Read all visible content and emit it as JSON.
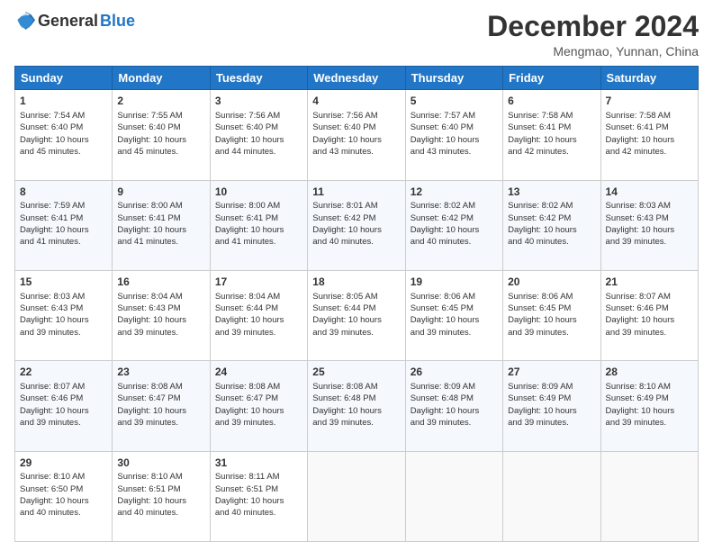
{
  "logo": {
    "general": "General",
    "blue": "Blue"
  },
  "header": {
    "month": "December 2024",
    "location": "Mengmao, Yunnan, China"
  },
  "weekdays": [
    "Sunday",
    "Monday",
    "Tuesday",
    "Wednesday",
    "Thursday",
    "Friday",
    "Saturday"
  ],
  "weeks": [
    [
      {
        "day": "1",
        "lines": [
          "Sunrise: 7:54 AM",
          "Sunset: 6:40 PM",
          "Daylight: 10 hours",
          "and 45 minutes."
        ]
      },
      {
        "day": "2",
        "lines": [
          "Sunrise: 7:55 AM",
          "Sunset: 6:40 PM",
          "Daylight: 10 hours",
          "and 45 minutes."
        ]
      },
      {
        "day": "3",
        "lines": [
          "Sunrise: 7:56 AM",
          "Sunset: 6:40 PM",
          "Daylight: 10 hours",
          "and 44 minutes."
        ]
      },
      {
        "day": "4",
        "lines": [
          "Sunrise: 7:56 AM",
          "Sunset: 6:40 PM",
          "Daylight: 10 hours",
          "and 43 minutes."
        ]
      },
      {
        "day": "5",
        "lines": [
          "Sunrise: 7:57 AM",
          "Sunset: 6:40 PM",
          "Daylight: 10 hours",
          "and 43 minutes."
        ]
      },
      {
        "day": "6",
        "lines": [
          "Sunrise: 7:58 AM",
          "Sunset: 6:41 PM",
          "Daylight: 10 hours",
          "and 42 minutes."
        ]
      },
      {
        "day": "7",
        "lines": [
          "Sunrise: 7:58 AM",
          "Sunset: 6:41 PM",
          "Daylight: 10 hours",
          "and 42 minutes."
        ]
      }
    ],
    [
      {
        "day": "8",
        "lines": [
          "Sunrise: 7:59 AM",
          "Sunset: 6:41 PM",
          "Daylight: 10 hours",
          "and 41 minutes."
        ]
      },
      {
        "day": "9",
        "lines": [
          "Sunrise: 8:00 AM",
          "Sunset: 6:41 PM",
          "Daylight: 10 hours",
          "and 41 minutes."
        ]
      },
      {
        "day": "10",
        "lines": [
          "Sunrise: 8:00 AM",
          "Sunset: 6:41 PM",
          "Daylight: 10 hours",
          "and 41 minutes."
        ]
      },
      {
        "day": "11",
        "lines": [
          "Sunrise: 8:01 AM",
          "Sunset: 6:42 PM",
          "Daylight: 10 hours",
          "and 40 minutes."
        ]
      },
      {
        "day": "12",
        "lines": [
          "Sunrise: 8:02 AM",
          "Sunset: 6:42 PM",
          "Daylight: 10 hours",
          "and 40 minutes."
        ]
      },
      {
        "day": "13",
        "lines": [
          "Sunrise: 8:02 AM",
          "Sunset: 6:42 PM",
          "Daylight: 10 hours",
          "and 40 minutes."
        ]
      },
      {
        "day": "14",
        "lines": [
          "Sunrise: 8:03 AM",
          "Sunset: 6:43 PM",
          "Daylight: 10 hours",
          "and 39 minutes."
        ]
      }
    ],
    [
      {
        "day": "15",
        "lines": [
          "Sunrise: 8:03 AM",
          "Sunset: 6:43 PM",
          "Daylight: 10 hours",
          "and 39 minutes."
        ]
      },
      {
        "day": "16",
        "lines": [
          "Sunrise: 8:04 AM",
          "Sunset: 6:43 PM",
          "Daylight: 10 hours",
          "and 39 minutes."
        ]
      },
      {
        "day": "17",
        "lines": [
          "Sunrise: 8:04 AM",
          "Sunset: 6:44 PM",
          "Daylight: 10 hours",
          "and 39 minutes."
        ]
      },
      {
        "day": "18",
        "lines": [
          "Sunrise: 8:05 AM",
          "Sunset: 6:44 PM",
          "Daylight: 10 hours",
          "and 39 minutes."
        ]
      },
      {
        "day": "19",
        "lines": [
          "Sunrise: 8:06 AM",
          "Sunset: 6:45 PM",
          "Daylight: 10 hours",
          "and 39 minutes."
        ]
      },
      {
        "day": "20",
        "lines": [
          "Sunrise: 8:06 AM",
          "Sunset: 6:45 PM",
          "Daylight: 10 hours",
          "and 39 minutes."
        ]
      },
      {
        "day": "21",
        "lines": [
          "Sunrise: 8:07 AM",
          "Sunset: 6:46 PM",
          "Daylight: 10 hours",
          "and 39 minutes."
        ]
      }
    ],
    [
      {
        "day": "22",
        "lines": [
          "Sunrise: 8:07 AM",
          "Sunset: 6:46 PM",
          "Daylight: 10 hours",
          "and 39 minutes."
        ]
      },
      {
        "day": "23",
        "lines": [
          "Sunrise: 8:08 AM",
          "Sunset: 6:47 PM",
          "Daylight: 10 hours",
          "and 39 minutes."
        ]
      },
      {
        "day": "24",
        "lines": [
          "Sunrise: 8:08 AM",
          "Sunset: 6:47 PM",
          "Daylight: 10 hours",
          "and 39 minutes."
        ]
      },
      {
        "day": "25",
        "lines": [
          "Sunrise: 8:08 AM",
          "Sunset: 6:48 PM",
          "Daylight: 10 hours",
          "and 39 minutes."
        ]
      },
      {
        "day": "26",
        "lines": [
          "Sunrise: 8:09 AM",
          "Sunset: 6:48 PM",
          "Daylight: 10 hours",
          "and 39 minutes."
        ]
      },
      {
        "day": "27",
        "lines": [
          "Sunrise: 8:09 AM",
          "Sunset: 6:49 PM",
          "Daylight: 10 hours",
          "and 39 minutes."
        ]
      },
      {
        "day": "28",
        "lines": [
          "Sunrise: 8:10 AM",
          "Sunset: 6:49 PM",
          "Daylight: 10 hours",
          "and 39 minutes."
        ]
      }
    ],
    [
      {
        "day": "29",
        "lines": [
          "Sunrise: 8:10 AM",
          "Sunset: 6:50 PM",
          "Daylight: 10 hours",
          "and 40 minutes."
        ]
      },
      {
        "day": "30",
        "lines": [
          "Sunrise: 8:10 AM",
          "Sunset: 6:51 PM",
          "Daylight: 10 hours",
          "and 40 minutes."
        ]
      },
      {
        "day": "31",
        "lines": [
          "Sunrise: 8:11 AM",
          "Sunset: 6:51 PM",
          "Daylight: 10 hours",
          "and 40 minutes."
        ]
      },
      null,
      null,
      null,
      null
    ]
  ]
}
